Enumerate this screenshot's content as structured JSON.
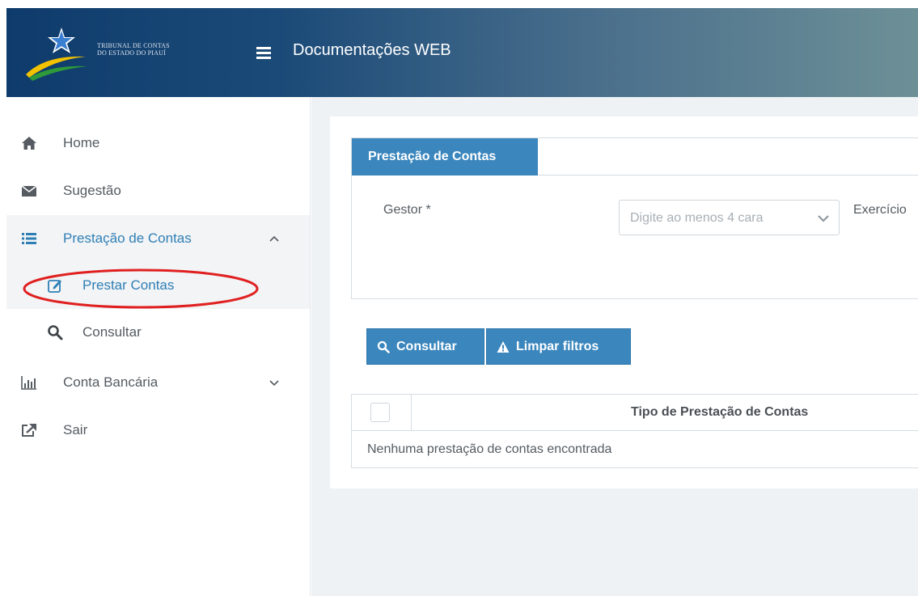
{
  "header": {
    "logo_line1": "TRIBUNAL DE CONTAS",
    "logo_line2": "DO ESTADO DO PIAUÍ",
    "app_title": "Documentações WEB"
  },
  "sidebar": {
    "items": [
      {
        "label": "Home",
        "icon": "home-icon"
      },
      {
        "label": "Sugestão",
        "icon": "envelope-icon"
      },
      {
        "label": "Prestação de Contas",
        "icon": "list-icon",
        "expanded": true
      },
      {
        "label": "Conta Bancária",
        "icon": "bar-chart-icon",
        "expanded": false
      },
      {
        "label": "Sair",
        "icon": "external-link-icon"
      }
    ],
    "subitems": [
      {
        "label": "Prestar Contas",
        "icon": "edit-icon",
        "selected": true
      },
      {
        "label": "Consultar",
        "icon": "search-icon",
        "selected": false
      }
    ]
  },
  "filter_panel": {
    "tab_label": "Prestação de Contas",
    "gestor_label": "Gestor *",
    "gestor_placeholder": "Digite ao menos 4 cara",
    "exercicio_label": "Exercício"
  },
  "actions": {
    "consultar_label": "Consultar",
    "limpar_label": "Limpar filtros"
  },
  "table": {
    "column_header": "Tipo de Prestação de Contas",
    "empty_message": "Nenhuma prestação de contas encontrada"
  },
  "colors": {
    "accent": "#3a86bd",
    "header_start": "#0e3b6b",
    "header_end": "#6d9097",
    "annotation": "#e02020"
  }
}
